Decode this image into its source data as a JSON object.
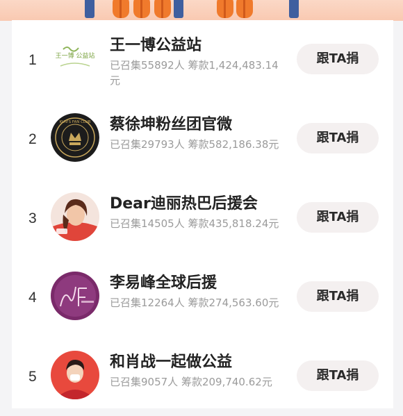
{
  "list": [
    {
      "rank": "1",
      "name": "王一博公益站",
      "avatar_text": "王一博 公益站",
      "stats": "已召集55892人 筹款1,424,483.14元",
      "button": "跟TA捐"
    },
    {
      "rank": "2",
      "name": "蔡徐坤粉丝团官微",
      "avatar_text": "KUN'S FAN CLUB",
      "stats": "已召集29793人 筹款582,186.38元",
      "button": "跟TA捐"
    },
    {
      "rank": "3",
      "name": "Dear迪丽热巴后援会",
      "avatar_text": "",
      "stats": "已召集14505人 筹款435,818.24元",
      "button": "跟TA捐"
    },
    {
      "rank": "4",
      "name": "李易峰全球后援",
      "avatar_text": "",
      "stats": "已召集12264人 筹款274,563.60元",
      "button": "跟TA捐"
    },
    {
      "rank": "5",
      "name": "和肖战一起做公益",
      "avatar_text": "",
      "stats": "已召集9057人 筹款209,740.62元",
      "button": "跟TA捐"
    }
  ],
  "colors": {
    "banner": "#f9c9b1",
    "button_bg": "#f4f0f0",
    "rank_text": "#333333",
    "stats_text": "#9b9b9b"
  }
}
